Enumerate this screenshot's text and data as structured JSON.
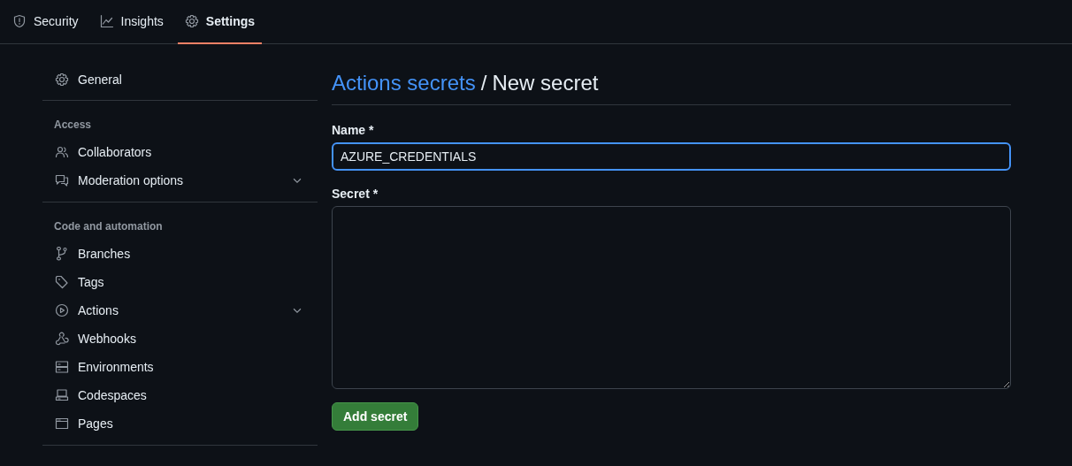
{
  "tabs": [
    {
      "label": "Security",
      "selected": false
    },
    {
      "label": "Insights",
      "selected": false
    },
    {
      "label": "Settings",
      "selected": true
    }
  ],
  "sidebar": {
    "sections": [
      {
        "items": [
          {
            "label": "General",
            "expandable": false
          }
        ]
      },
      {
        "heading": "Access",
        "items": [
          {
            "label": "Collaborators",
            "expandable": false
          },
          {
            "label": "Moderation options",
            "expandable": true
          }
        ]
      },
      {
        "heading": "Code and automation",
        "items": [
          {
            "label": "Branches",
            "expandable": false
          },
          {
            "label": "Tags",
            "expandable": false
          },
          {
            "label": "Actions",
            "expandable": true
          },
          {
            "label": "Webhooks",
            "expandable": false
          },
          {
            "label": "Environments",
            "expandable": false
          },
          {
            "label": "Codespaces",
            "expandable": false
          },
          {
            "label": "Pages",
            "expandable": false
          }
        ]
      }
    ]
  },
  "page": {
    "breadcrumb_link": "Actions secrets",
    "separator": "/",
    "title": "New secret",
    "name_label": "Name *",
    "name_value": "AZURE_CREDENTIALS",
    "secret_label": "Secret *",
    "submit": "Add secret"
  }
}
